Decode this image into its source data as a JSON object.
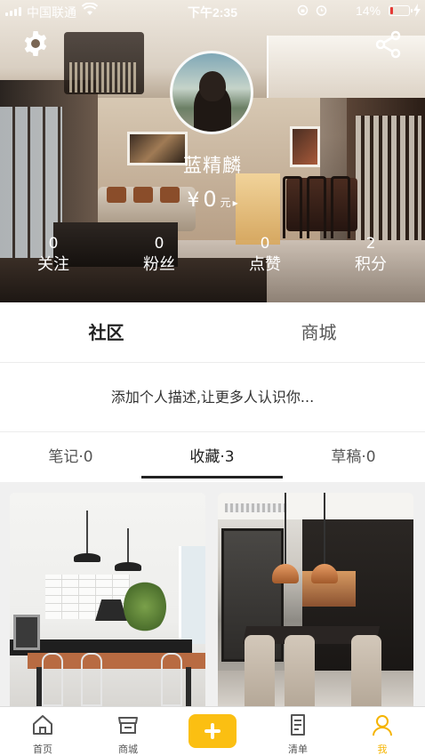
{
  "status_bar": {
    "carrier": "中国联通",
    "time": "下午2:35",
    "battery_percent": "14%",
    "battery_level": 0.14,
    "icons": [
      "signal-icon",
      "wifi-icon",
      "orientation-lock-icon",
      "alarm-icon",
      "battery-icon",
      "charging-icon"
    ]
  },
  "header": {
    "settings_icon": "gear-icon",
    "share_icon": "share-icon"
  },
  "profile": {
    "username": "蓝精麟",
    "balance_currency": "¥",
    "balance_amount": "0",
    "balance_unit": "元",
    "balance_chevron": "▸"
  },
  "stats": [
    {
      "value": "0",
      "label": "关注"
    },
    {
      "value": "0",
      "label": "粉丝"
    },
    {
      "value": "0",
      "label": "点赞"
    },
    {
      "value": "2",
      "label": "积分"
    }
  ],
  "main_tabs": [
    {
      "label": "社区",
      "active": true
    },
    {
      "label": "商城",
      "active": false
    }
  ],
  "bio_placeholder": "添加个人描述,让更多人认识你...",
  "sub_tabs": [
    {
      "label": "笔记·0",
      "active": false
    },
    {
      "label": "收藏·3",
      "active": true
    },
    {
      "label": "草稿·0",
      "active": false
    }
  ],
  "bottom_nav": [
    {
      "label": "首页",
      "icon": "home-icon",
      "active": false
    },
    {
      "label": "商城",
      "icon": "shop-icon",
      "active": false
    },
    {
      "label": "",
      "icon": "plus-icon",
      "active": false
    },
    {
      "label": "清单",
      "icon": "list-icon",
      "active": false
    },
    {
      "label": "我",
      "icon": "user-icon",
      "active": true
    }
  ],
  "colors": {
    "accent": "#fbbf12",
    "active_nav_label": "#f5b400",
    "battery_low": "#e53935"
  }
}
